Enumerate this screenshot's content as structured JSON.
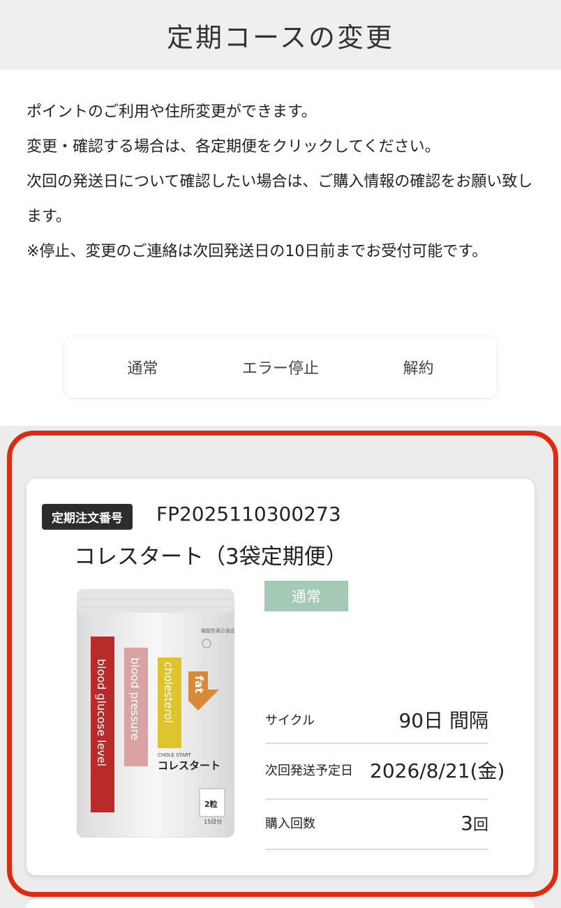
{
  "page_title": "定期コースの変更",
  "intro_lines": [
    "ポイントのご利用や住所変更ができます。",
    "変更・確認する場合は、各定期便をクリックしてください。",
    "次回の発送日について確認したい場合は、ご購入情報の確認をお願い致します。",
    "※停止、変更のご連絡は次回発送日の10日前までお受付可能です。"
  ],
  "filter_tabs": [
    "通常",
    "エラー停止",
    "解約"
  ],
  "subscription": {
    "order_badge": "定期注文番号",
    "order_number": "FP2025110300273",
    "product_name": "コレスタート（3袋定期便）",
    "status": "通常",
    "rows": [
      {
        "label": "サイクル",
        "value": "90日 間隔"
      },
      {
        "label": "次回発送予定日",
        "value": "2026/8/21(金)"
      },
      {
        "label": "購入回数",
        "value_number": "3",
        "value_unit": "回"
      }
    ],
    "package": {
      "top_label": "機能性表示食品",
      "brand": "CHOLE START",
      "name_jp": "コレスタート",
      "stripes": [
        "blood glucose level",
        "blood pressure",
        "cholesterol",
        "fat"
      ],
      "dose": "2粒",
      "days": "15日分"
    }
  },
  "colors": {
    "highlight": "#dd2a10",
    "status_badge": "#a4cab5",
    "stripe_red": "#b92a2a",
    "stripe_pink": "#d9a3a3",
    "stripe_yellow": "#e0c42e",
    "stripe_orange": "#d9893a"
  }
}
